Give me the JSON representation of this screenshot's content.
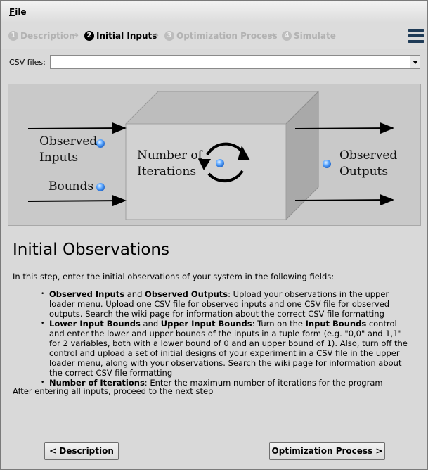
{
  "menubar": {
    "file_label": "File",
    "file_mnemonic": "F",
    "file_rest": "ile"
  },
  "steps": [
    {
      "num": "1",
      "label": "Description"
    },
    {
      "num": "2",
      "label": "Initial Inputs"
    },
    {
      "num": "3",
      "label": "Optimization Process"
    },
    {
      "num": "4",
      "label": "Simulate"
    }
  ],
  "step_arrow": "➔",
  "csv": {
    "label": "CSV files:",
    "value": ""
  },
  "diagram": {
    "observed_inputs": "Observed\nInputs",
    "bounds": "Bounds",
    "iterations": "Number of\nIterations",
    "observed_outputs": "Observed\nOutputs"
  },
  "content": {
    "title": "Initial Observations",
    "intro": "In this step, enter the initial observations of your system in the following fields:",
    "bullets": [
      {
        "bold1": "Observed Inputs",
        "mid1": " and ",
        "bold2": "Observed Outputs",
        "text": ": Upload your observations in the upper loader menu. Upload one CSV file for observed inputs and one CSV file for observed outputs. Search the wiki page for information about the correct CSV file formatting"
      },
      {
        "bold1": "Lower Input Bounds",
        "mid1": " and ",
        "bold2": "Upper Input Bounds",
        "text_a": ": Turn on the ",
        "bold3": "Input Bounds",
        "text_b": " control and enter the lower and upper bounds of the inputs in a tuple form (e.g. \"0,0\" and 1,1\" for 2 variables, both with a lower bound of 0 and an upper bound of 1). Also, turn off the control and upload a set of initial designs of your experiment in a CSV file in the upper loader menu, along with your observations. Search the wiki page for information about the correct CSV file formatting"
      },
      {
        "bold1": "Number of Iterations",
        "text": ": Enter the maximum number of iterations for the program"
      }
    ],
    "outro": "After entering all inputs, proceed to the next step"
  },
  "buttons": {
    "prev": "< Description",
    "next": "Optimization Process >"
  },
  "colors": {
    "hamburger": "#1f3b57",
    "diagram_bg": "#c9c9c9",
    "box_front": "#d2d2d2",
    "box_top": "#bdbdbd",
    "box_side": "#a9a9a9",
    "dot": "#5aa6ff"
  },
  "icons": [
    "hamburger-menu-icon",
    "refresh-cycle-icon",
    "dropdown-arrow-icon"
  ]
}
